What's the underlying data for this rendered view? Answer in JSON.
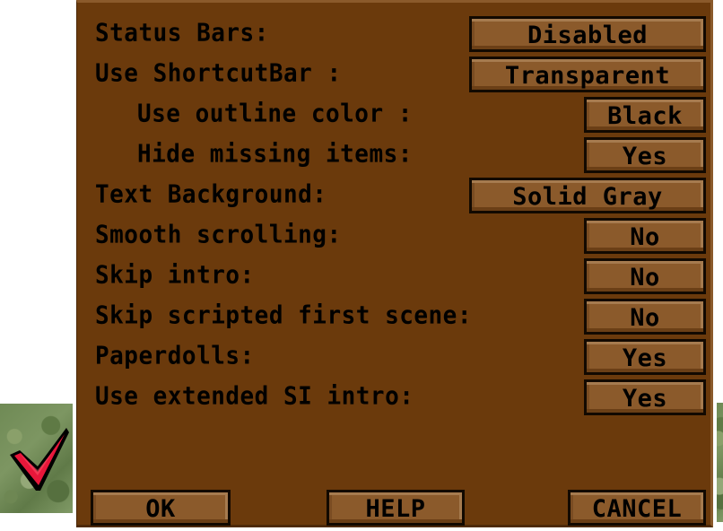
{
  "options": [
    {
      "label": "Status Bars:",
      "value": "Disabled",
      "indent": false,
      "wide": true
    },
    {
      "label": "Use ShortcutBar :",
      "value": "Transparent",
      "indent": false,
      "wide": true
    },
    {
      "label": "Use outline color :",
      "value": "Black",
      "indent": true,
      "wide": false
    },
    {
      "label": "Hide missing items:",
      "value": "Yes",
      "indent": true,
      "wide": false
    },
    {
      "label": "Text Background:",
      "value": "Solid Gray",
      "indent": false,
      "wide": true
    },
    {
      "label": "Smooth scrolling:",
      "value": "No",
      "indent": false,
      "wide": false
    },
    {
      "label": "Skip intro:",
      "value": "No",
      "indent": false,
      "wide": false
    },
    {
      "label": "Skip scripted first scene:",
      "value": "No",
      "indent": false,
      "wide": false
    },
    {
      "label": "Paperdolls:",
      "value": "Yes",
      "indent": false,
      "wide": false
    },
    {
      "label": "Use extended SI intro:",
      "value": "Yes",
      "indent": false,
      "wide": false
    }
  ],
  "footer": {
    "ok_label": "OK",
    "help_label": "HELP",
    "cancel_label": "CANCEL"
  },
  "icons": {
    "left_tile": "checkmark-icon",
    "right_tile": "stone-tile"
  },
  "colors": {
    "panel": "#6b3a0c",
    "button_face": "#8b5a2b",
    "text": "#000000",
    "checkmark": "#e8173a",
    "tile": "#6f8a55"
  }
}
